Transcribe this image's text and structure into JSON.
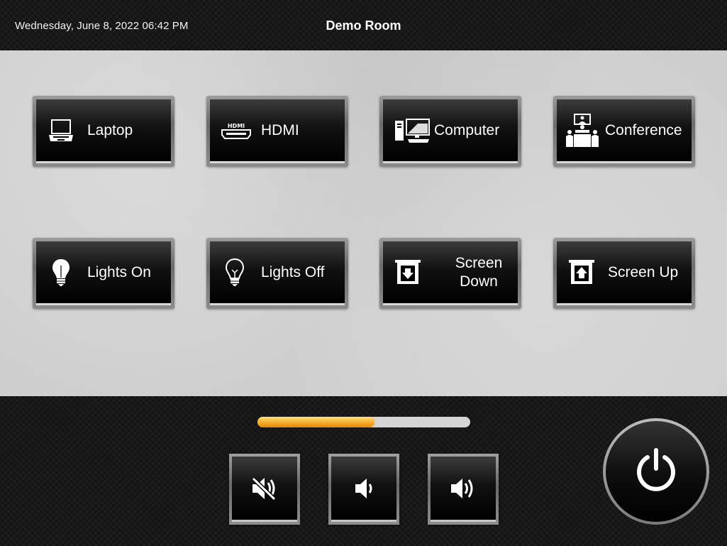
{
  "header": {
    "datetime": "Wednesday, June 8, 2022 06:42 PM",
    "room_title": "Demo Room"
  },
  "buttons": {
    "laptop": {
      "label": "Laptop",
      "icon": "laptop-icon"
    },
    "hdmi": {
      "label": "HDMI",
      "icon": "hdmi-icon"
    },
    "computer": {
      "label": "Computer",
      "icon": "computer-icon"
    },
    "conference": {
      "label": "Conference",
      "icon": "conference-icon"
    },
    "lights_on": {
      "label": "Lights On",
      "icon": "lightbulb-on-icon"
    },
    "lights_off": {
      "label": "Lights Off",
      "icon": "lightbulb-off-icon"
    },
    "screen_down": {
      "label_line1": "Screen",
      "label_line2": "Down",
      "icon": "screen-down-icon"
    },
    "screen_up": {
      "label": "Screen Up",
      "icon": "screen-up-icon"
    }
  },
  "volume": {
    "level_percent": 55,
    "mute_icon": "mute-icon",
    "down_icon": "volume-down-icon",
    "up_icon": "volume-up-icon"
  },
  "power": {
    "icon": "power-icon"
  },
  "colors": {
    "volume_fill": "#f6a623",
    "panel_background": "#cfcfcf",
    "button_face": "#000000",
    "text": "#ffffff"
  }
}
